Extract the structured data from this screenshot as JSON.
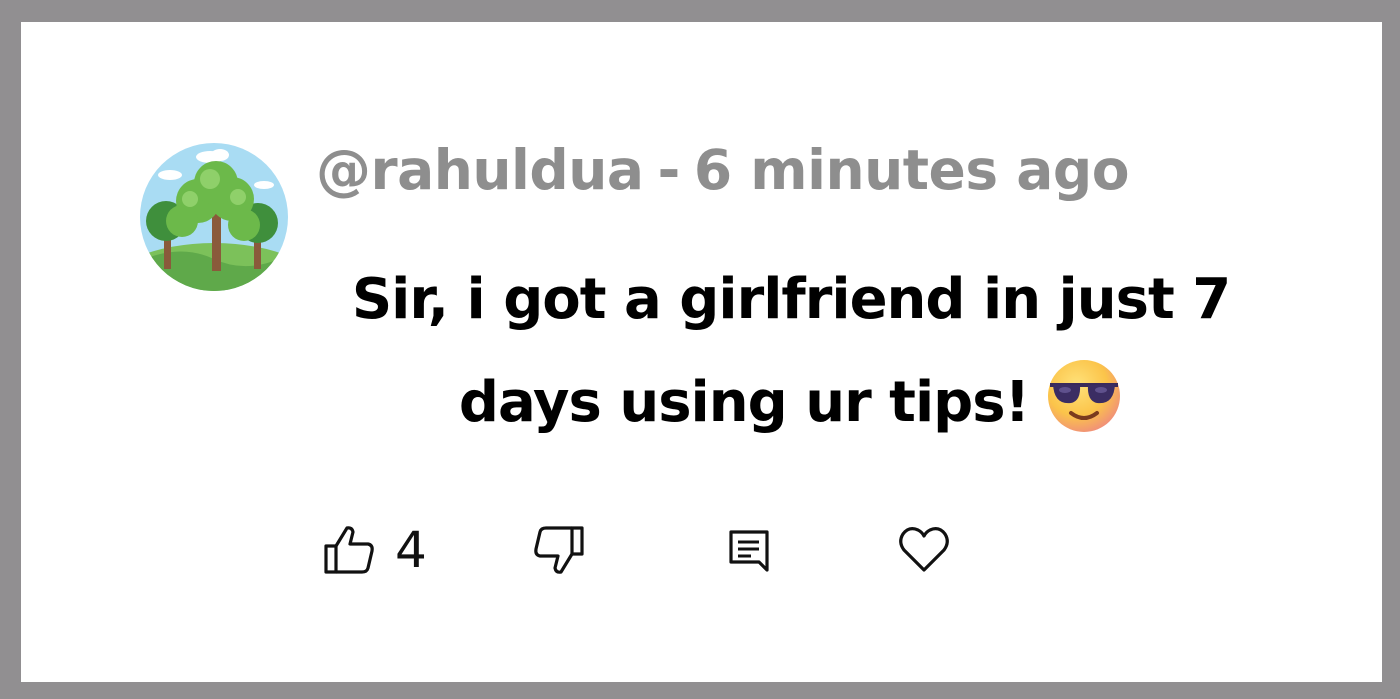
{
  "comment": {
    "username": "@rahuldua",
    "separator": "-",
    "timestamp": "6 minutes ago",
    "text": "Sir, i got a girlfriend in just 7 days using ur tips!",
    "emoji": "smiling-face-with-sunglasses",
    "avatar": "tree-landscape-avatar"
  },
  "actions": {
    "like_icon": "thumbs-up-icon",
    "like_count": "4",
    "dislike_icon": "thumbs-down-icon",
    "reply_icon": "comment-icon",
    "heart_icon": "heart-icon"
  },
  "colors": {
    "frame": "#918f91",
    "card": "#ffffff",
    "meta_text": "#8e8e8e",
    "comment_text": "#000000"
  }
}
